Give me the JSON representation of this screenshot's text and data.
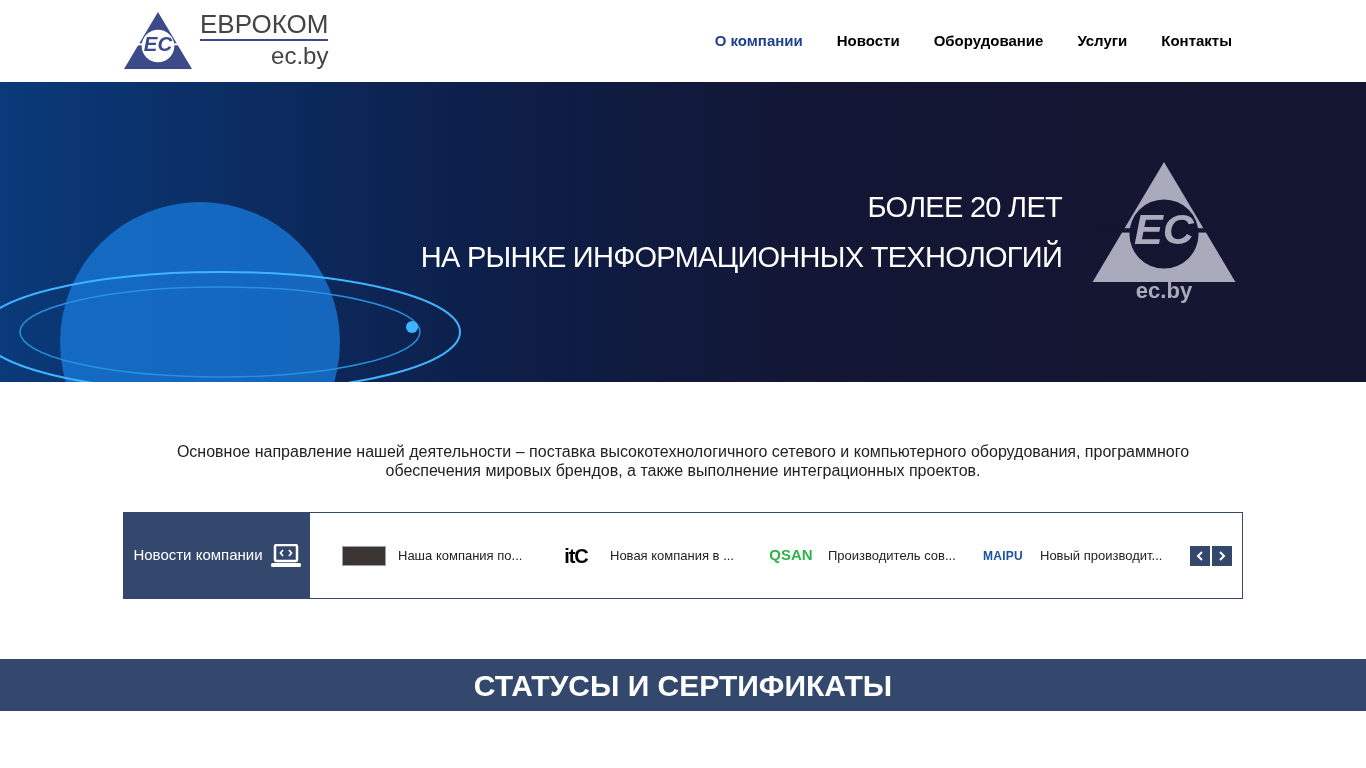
{
  "header": {
    "logo": {
      "mark": "EC",
      "name": "ЕВРОКОМ",
      "domain": "ec.by"
    },
    "nav": [
      {
        "label": "О компании",
        "selected": true
      },
      {
        "label": "Новости",
        "selected": false
      },
      {
        "label": "Оборудование",
        "selected": false
      },
      {
        "label": "Услуги",
        "selected": false
      },
      {
        "label": "Контакты",
        "selected": false
      }
    ]
  },
  "hero": {
    "lines": [
      "БОЛЕЕ 20 ЛЕТ",
      "НА РЫНКЕ ИНФОРМАЦИОННЫХ ТЕХНОЛОГИЙ"
    ],
    "logo": {
      "mark": "EC",
      "domain": "ec.by"
    }
  },
  "intro": "Основное направление нашей деятельности – поставка высокотехнологичного сетевого и компьютерного оборудования, программного обеспечения мировых брендов, а также выполнение интеграционных проектов.",
  "news": {
    "title": "Новости компании",
    "items": [
      {
        "kind": "badge",
        "title": "Наша компания по..."
      },
      {
        "kind": "itc",
        "logo": "itC",
        "title": "Новая компания в ..."
      },
      {
        "kind": "qsan",
        "logo": "QSAN",
        "title": "Производитель сов..."
      },
      {
        "kind": "maipu",
        "logo": "MAIPU",
        "title": "Новый производит..."
      }
    ]
  },
  "section_title": "СТАТУСЫ И СЕРТИФИКАТЫ"
}
